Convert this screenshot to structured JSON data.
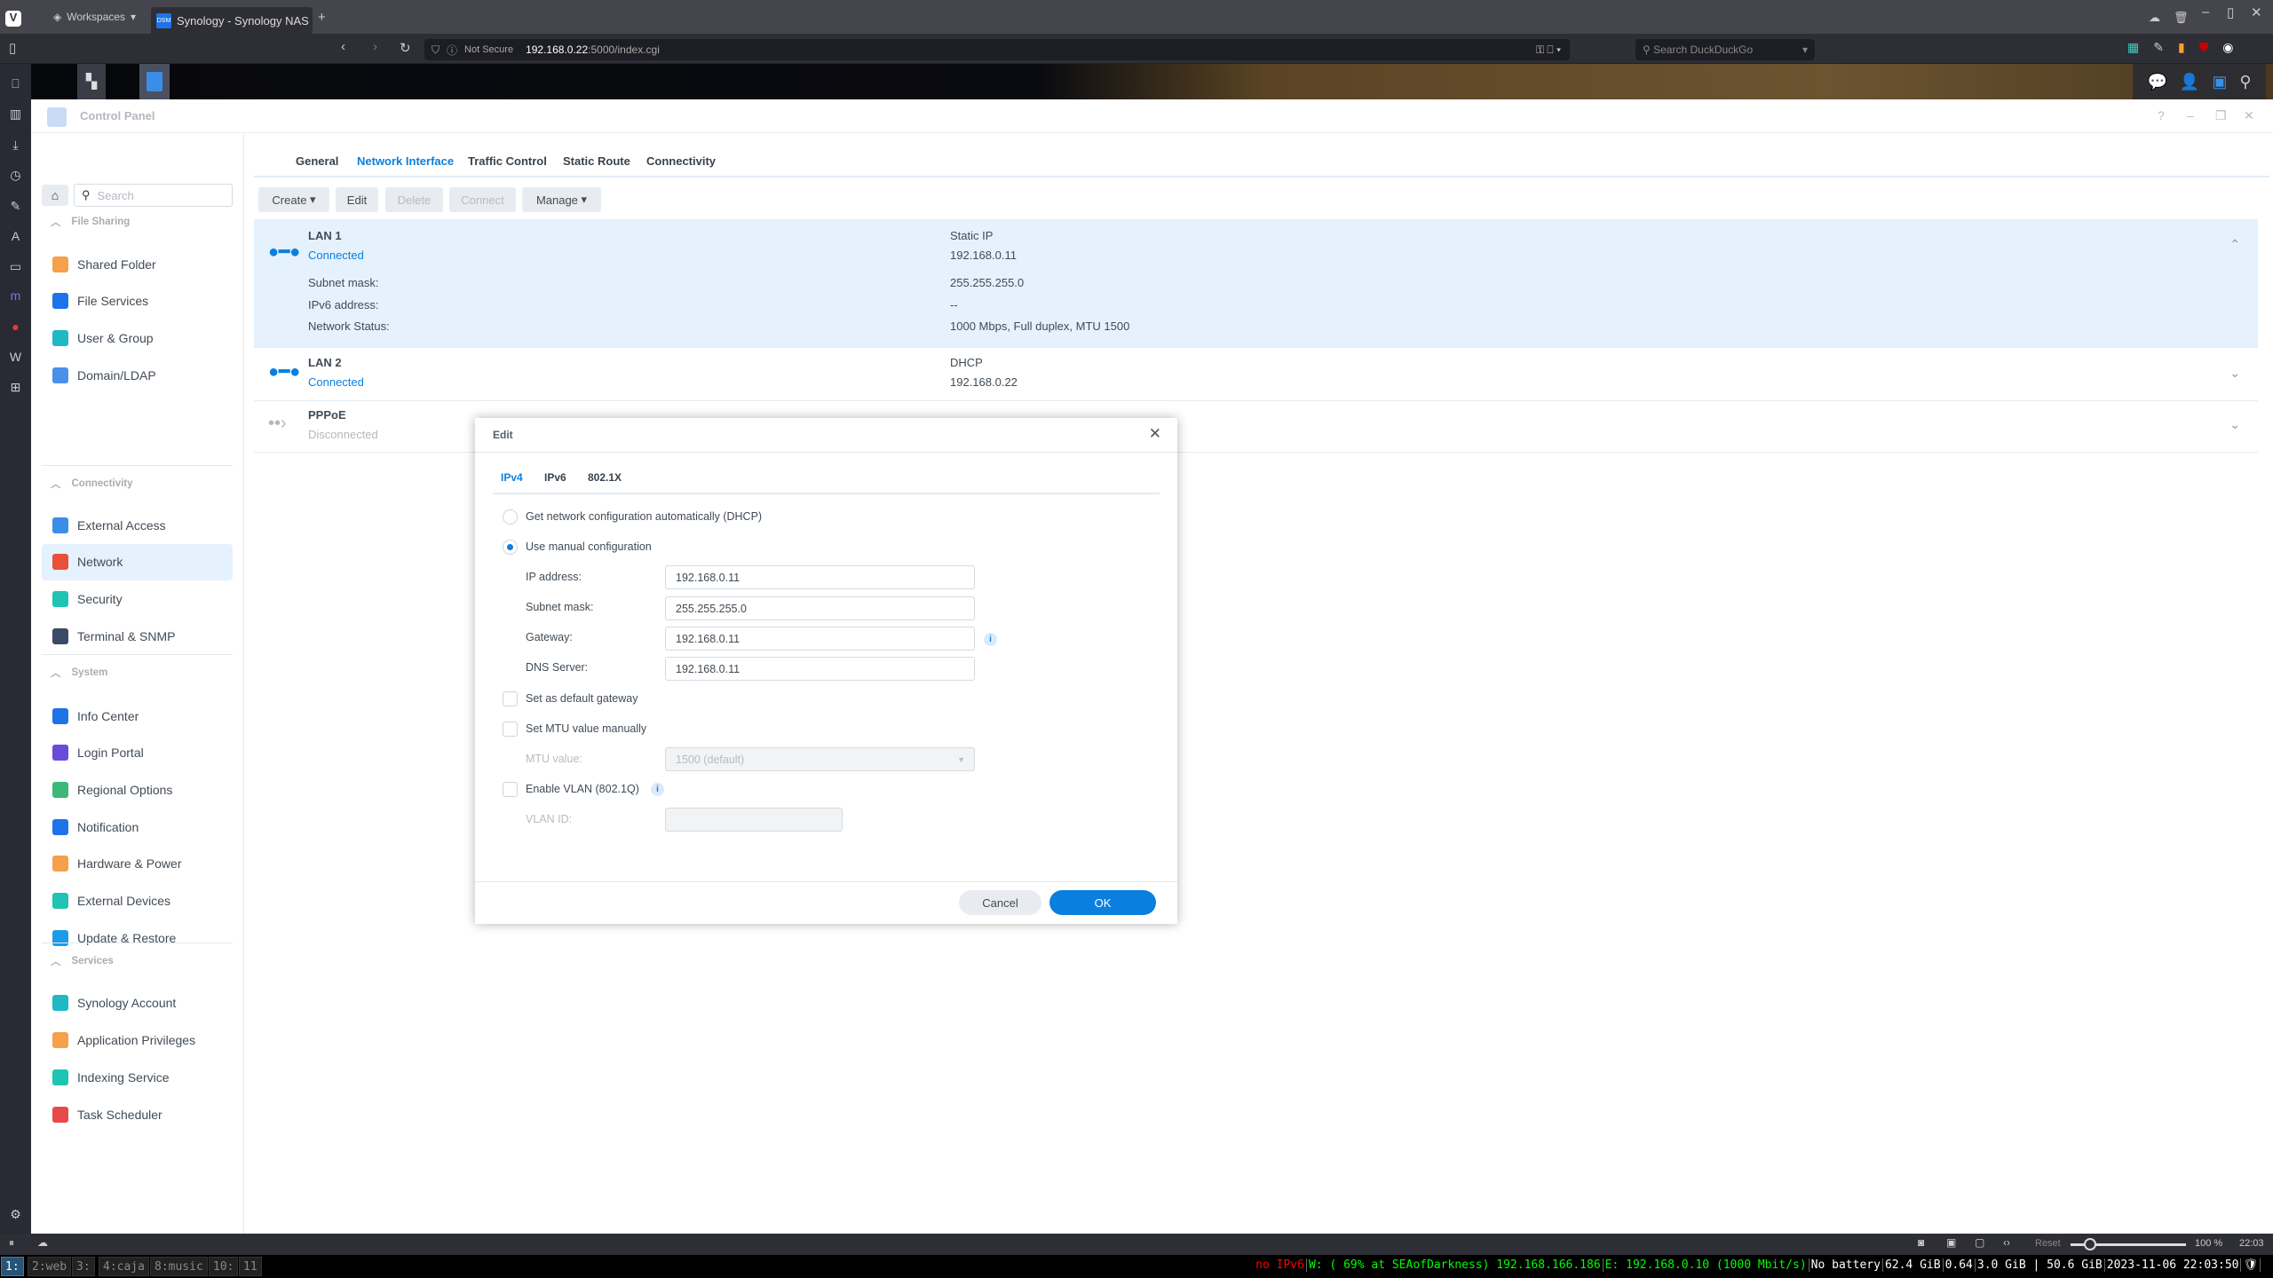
{
  "browser": {
    "workspaces_label": "Workspaces",
    "tab_title": "Synology - Synology NAS",
    "tab_favicon": "DSM",
    "not_secure": "Not Secure",
    "url_host": "192.168.0.22",
    "url_rest": ":5000/index.cgi",
    "search_placeholder": "Search DuckDuckGo"
  },
  "window": {
    "title": "Control Panel"
  },
  "sidebar": {
    "search_placeholder": "Search",
    "sections": [
      {
        "header": "File Sharing",
        "items": [
          {
            "label": "Shared Folder",
            "color": "#f5a04a"
          },
          {
            "label": "File Services",
            "color": "#1e73e8"
          },
          {
            "label": "User & Group",
            "color": "#1fb8c4"
          },
          {
            "label": "Domain/LDAP",
            "color": "#4a90e8"
          }
        ]
      },
      {
        "header": "Connectivity",
        "items": [
          {
            "label": "External Access",
            "color": "#3a8ee8"
          },
          {
            "label": "Network",
            "color": "#e8503a",
            "active": true
          },
          {
            "label": "Security",
            "color": "#1fc4b4"
          },
          {
            "label": "Terminal & SNMP",
            "color": "#3b4a66"
          }
        ]
      },
      {
        "header": "System",
        "items": [
          {
            "label": "Info Center",
            "color": "#1e73e8"
          },
          {
            "label": "Login Portal",
            "color": "#6a4ad8"
          },
          {
            "label": "Regional Options",
            "color": "#3cb878"
          },
          {
            "label": "Notification",
            "color": "#1e73e8"
          },
          {
            "label": "Hardware & Power",
            "color": "#f5a04a"
          },
          {
            "label": "External Devices",
            "color": "#1fc4b4"
          },
          {
            "label": "Update & Restore",
            "color": "#1e9be8"
          }
        ]
      },
      {
        "header": "Services",
        "items": [
          {
            "label": "Synology Account",
            "color": "#1fb8c4"
          },
          {
            "label": "Application Privileges",
            "color": "#f5a04a"
          },
          {
            "label": "Indexing Service",
            "color": "#1fc4b4"
          },
          {
            "label": "Task Scheduler",
            "color": "#e84a4a"
          }
        ]
      }
    ]
  },
  "main": {
    "tabs": [
      "General",
      "Network Interface",
      "Traffic Control",
      "Static Route",
      "Connectivity"
    ],
    "active_tab": "Network Interface",
    "toolbar": {
      "create": "Create",
      "edit": "Edit",
      "delete": "Delete",
      "connect": "Connect",
      "manage": "Manage"
    },
    "interfaces": [
      {
        "name": "LAN 1",
        "status": "Connected",
        "type": "Static IP",
        "ip": "192.168.0.11",
        "details": [
          {
            "label": "Subnet mask:",
            "value": "255.255.255.0"
          },
          {
            "label": "IPv6 address:",
            "value": "--"
          },
          {
            "label": "Network Status:",
            "value": "1000 Mbps, Full duplex, MTU 1500"
          }
        ]
      },
      {
        "name": "LAN 2",
        "status": "Connected",
        "type": "DHCP",
        "ip": "192.168.0.22"
      },
      {
        "name": "PPPoE",
        "status": "Disconnected"
      }
    ]
  },
  "dialog": {
    "title": "Edit",
    "tabs": [
      "IPv4",
      "IPv6",
      "802.1X"
    ],
    "active_tab": "IPv4",
    "dhcp_label": "Get network configuration automatically (DHCP)",
    "manual_label": "Use manual configuration",
    "mode": "manual",
    "fields": {
      "ip_label": "IP address:",
      "ip": "192.168.0.11",
      "subnet_label": "Subnet mask:",
      "subnet": "255.255.255.0",
      "gateway_label": "Gateway:",
      "gateway": "192.168.0.11",
      "dns_label": "DNS Server:",
      "dns": "192.168.0.11"
    },
    "default_gateway_label": "Set as default gateway",
    "default_gateway_checked": false,
    "mtu_manual_label": "Set MTU value manually",
    "mtu_manual_checked": false,
    "mtu_value_label": "MTU value:",
    "mtu_value": "1500 (default)",
    "vlan_label": "Enable VLAN (802.1Q)",
    "vlan_checked": false,
    "vlan_id_label": "VLAN ID:",
    "vlan_id": "",
    "cancel": "Cancel",
    "ok": "OK"
  },
  "status_bar": {
    "reset": "Reset",
    "zoom": "100 %",
    "time": "22:03",
    "zoom_percent": 100
  },
  "i3bar": {
    "workspaces": [
      "1:",
      "2:web",
      "3:",
      "4:caja",
      "8:music",
      "10:",
      "11"
    ],
    "focused": "1:",
    "blocks": [
      {
        "text": "no IPv6",
        "color": "#ff0000"
      },
      {
        "text": "W: ( 69% at SEAofDarkness) 192.168.166.186",
        "color": "#00ff00"
      },
      {
        "text": "E: 192.168.0.10 (1000 Mbit/s)",
        "color": "#00ff00"
      },
      {
        "text": "No battery",
        "color": "#ffffff"
      },
      {
        "text": "62.4 GiB",
        "color": "#ffffff"
      },
      {
        "text": "0.64",
        "color": "#ffffff"
      },
      {
        "text": "3.0 GiB | 50.6 GiB",
        "color": "#ffffff"
      },
      {
        "text": "2023-11-06 22:03:50",
        "color": "#ffffff"
      }
    ]
  },
  "colors": {
    "accent": "#0b7fe0",
    "selected_row": "#e5f1fc"
  }
}
